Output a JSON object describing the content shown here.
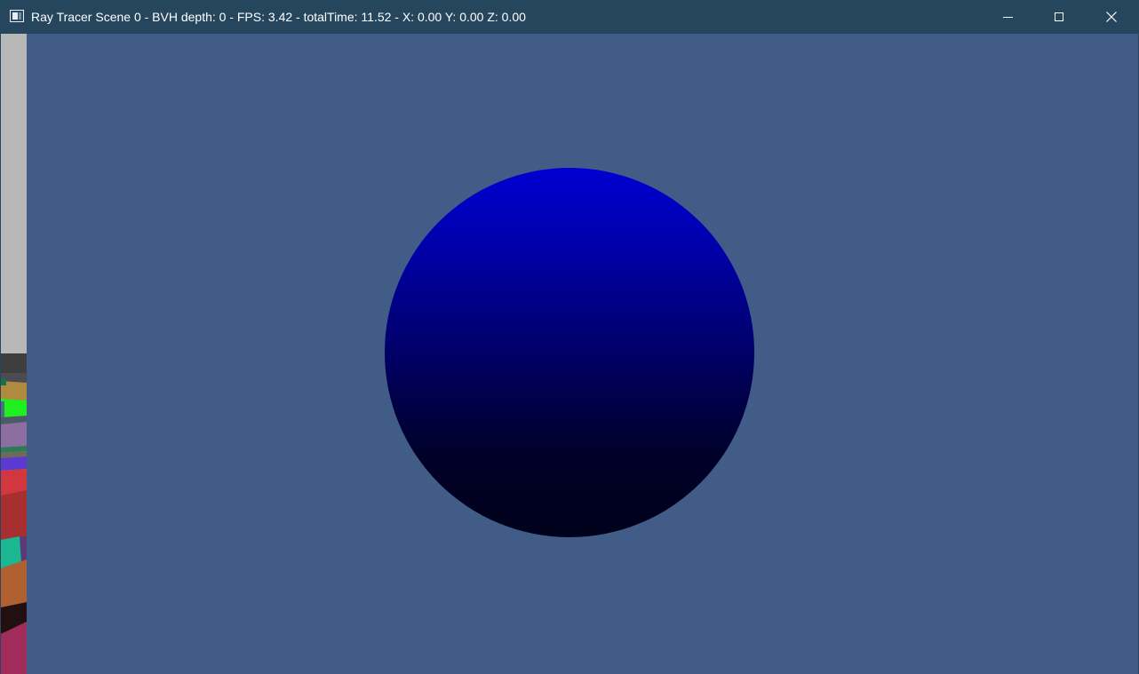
{
  "window": {
    "title": "Ray Tracer Scene 0 - BVH depth: 0 - FPS: 3.42 - totalTime: 11.52 - X: 0.00 Y: 0.00 Z: 0.00",
    "buttons": {
      "minimize": "minimize",
      "maximize": "maximize",
      "close": "close"
    },
    "colors": {
      "titlebar": "#26465d",
      "background": "#405c87",
      "sphere_top": "#0000d2",
      "sphere_bottom": "#00011a"
    }
  },
  "scene": {
    "objects": [
      "blue-sphere",
      "colored-geometry-strip"
    ]
  }
}
